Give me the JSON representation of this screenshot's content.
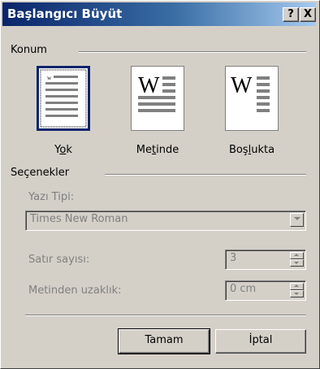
{
  "window": {
    "title": "Başlangıcı Büyüt",
    "help_button": "?",
    "close_button": "X"
  },
  "position_group": {
    "label": "Konum",
    "options": [
      {
        "label_pre": "Y",
        "label_u": "o",
        "label_post": "k",
        "selected": true,
        "icon": "dropcap-none-icon"
      },
      {
        "label_pre": "Me",
        "label_u": "t",
        "label_post": "inde",
        "selected": false,
        "icon": "dropcap-dropped-icon",
        "letter": "W"
      },
      {
        "label_pre": "Boş",
        "label_u": "l",
        "label_post": "ukta",
        "selected": false,
        "icon": "dropcap-margin-icon",
        "letter": "W"
      }
    ]
  },
  "options_group": {
    "label": "Seçenekler",
    "font_label": "Yazı Tipi:",
    "font_value": "Times New Roman",
    "lines_label": "Satır sayısı:",
    "lines_value": "3",
    "distance_label": "Metinden uzaklık:",
    "distance_value": "0 cm"
  },
  "buttons": {
    "ok": "Tamam",
    "cancel": "İptal"
  },
  "colors": {
    "titlebar_start": "#0a246a",
    "titlebar_end": "#a6caf0",
    "dialog_bg": "#d4d0c8"
  }
}
